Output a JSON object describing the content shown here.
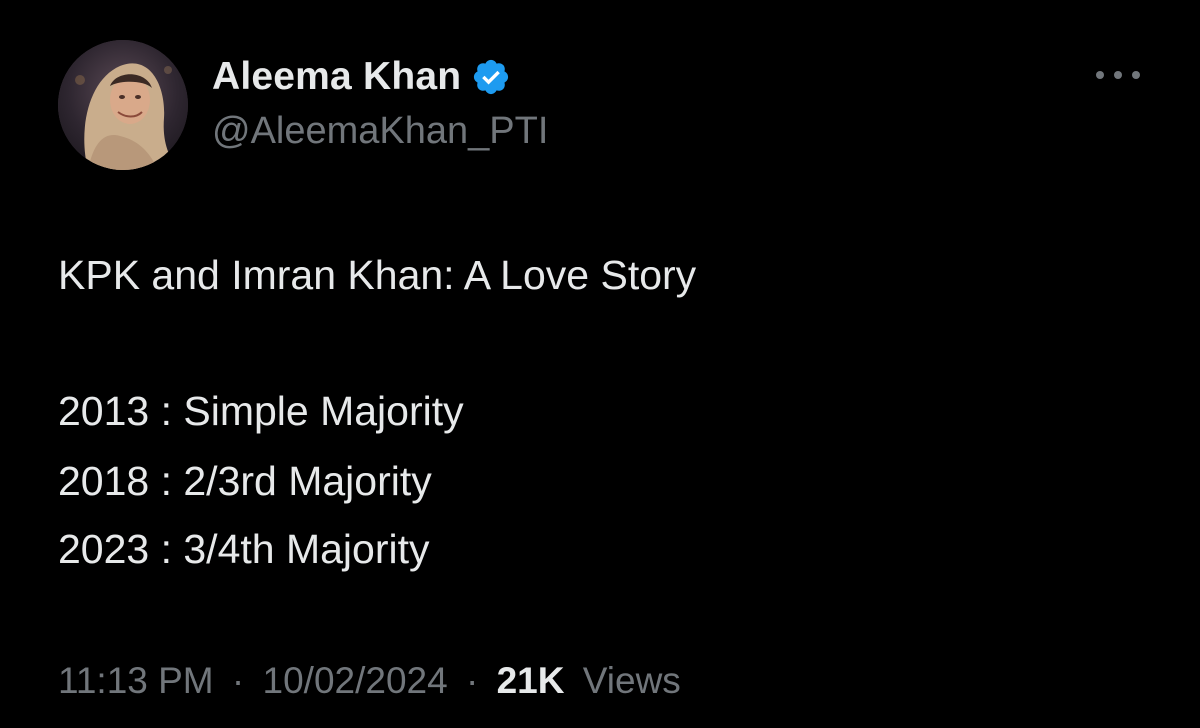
{
  "author": {
    "display_name": "Aleema Khan",
    "handle": "@AleemaKhan_PTI",
    "verified_icon": "verified-badge-icon",
    "avatar": "profile-photo"
  },
  "menu_icon": "more-options-icon",
  "tweet": {
    "lines": [
      "KPK and Imran Khan: A Love Story",
      "2013 : Simple Majority",
      "2018 : 2/3rd Majority",
      "2023 : 3/4th Majority"
    ]
  },
  "meta": {
    "time": "11:13 PM",
    "separator": "·",
    "date": "10/02/2024",
    "views_count": "21K",
    "views_label": "Views"
  },
  "colors": {
    "background": "#000000",
    "primary_text": "#e7e9ea",
    "secondary_text": "#71767b",
    "verified_blue": "#1d9bf0"
  }
}
